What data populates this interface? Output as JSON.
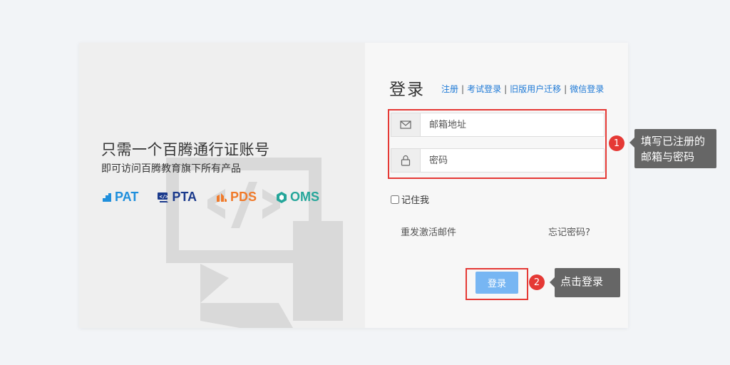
{
  "left_panel": {
    "slogan": "只需一个百腾通行证账号",
    "subslogan": "即可访问百腾教育旗下所有产品",
    "brands": [
      {
        "label": "PAT",
        "color": "#1f8fdc",
        "icon": "pat-icon"
      },
      {
        "label": "PTA",
        "color": "#1b3a8c",
        "icon": "pta-icon"
      },
      {
        "label": "PDS",
        "color": "#f07a2a",
        "icon": "pds-icon"
      },
      {
        "label": "OMS",
        "color": "#25a69a",
        "icon": "oms-icon"
      }
    ]
  },
  "login": {
    "title": "登录",
    "links": [
      "注册",
      "考试登录",
      "旧版用户迁移",
      "微信登录"
    ],
    "separator": "|",
    "email_placeholder": "邮箱地址",
    "password_placeholder": "密码",
    "remember_label": "记住我",
    "resend_label": "重发激活邮件",
    "forgot_label": "忘记密码?",
    "submit_label": "登录"
  },
  "annotations": {
    "step1_number": "1",
    "step1_text_line1": "填写已注册的",
    "step1_text_line2": "邮箱与密码",
    "step2_number": "2",
    "step2_text": "点击登录"
  },
  "colors": {
    "link": "#1f7ad6",
    "button": "#77b6f3",
    "highlight": "#e53935",
    "tooltip": "#666666"
  }
}
